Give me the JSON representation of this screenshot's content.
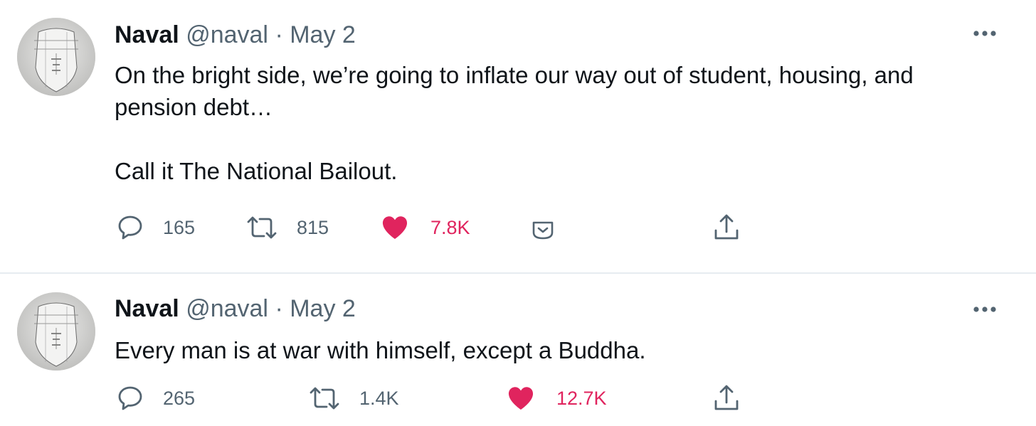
{
  "colors": {
    "text": "#0f1419",
    "secondary": "#536471",
    "like": "#e0245e",
    "divider": "#e6ecf0"
  },
  "tweets": [
    {
      "name": "Naval",
      "handle": "@naval",
      "separator": "·",
      "date": "May 2",
      "text_paragraphs": [
        "On the bright side, we’re going to inflate our way out of student, housing, and pension debt…",
        "Call it The National Bailout."
      ],
      "actions": {
        "replies": "165",
        "retweets": "815",
        "likes": "7.8K"
      },
      "liked": true,
      "icons": [
        "reply-icon",
        "retweet-icon",
        "heart-icon",
        "tip-icon",
        "share-icon",
        "more-icon"
      ]
    },
    {
      "name": "Naval",
      "handle": "@naval",
      "separator": "·",
      "date": "May 2",
      "text_paragraphs": [
        "Every man is at war with himself, except a Buddha."
      ],
      "actions": {
        "replies": "265",
        "retweets": "1.4K",
        "likes": "12.7K"
      },
      "liked": true,
      "icons": [
        "reply-icon",
        "retweet-icon",
        "heart-icon",
        "share-icon",
        "more-icon"
      ]
    }
  ]
}
